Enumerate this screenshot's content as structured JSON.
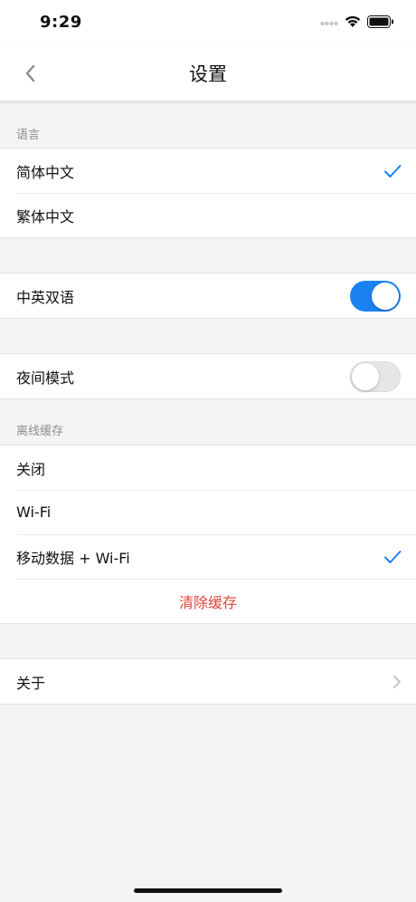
{
  "status_bar": {
    "time": "9:29"
  },
  "nav": {
    "title": "设置",
    "back_icon": "chevron-left-icon"
  },
  "language": {
    "header": "语言",
    "options": [
      "简体中文",
      "繁体中文"
    ],
    "selected_index": 0
  },
  "bilingual": {
    "label": "中英双语",
    "enabled": true
  },
  "night_mode": {
    "label": "夜间模式",
    "enabled": false
  },
  "offline_cache": {
    "header": "离线缓存",
    "options": [
      "关闭",
      "Wi-Fi",
      "移动数据 + Wi-Fi"
    ],
    "selected_index": 2,
    "clear_label": "清除缓存"
  },
  "about": {
    "label": "关于"
  },
  "colors": {
    "accent": "#1a82f0",
    "danger": "#e0463c",
    "background": "#f4f4f4"
  }
}
